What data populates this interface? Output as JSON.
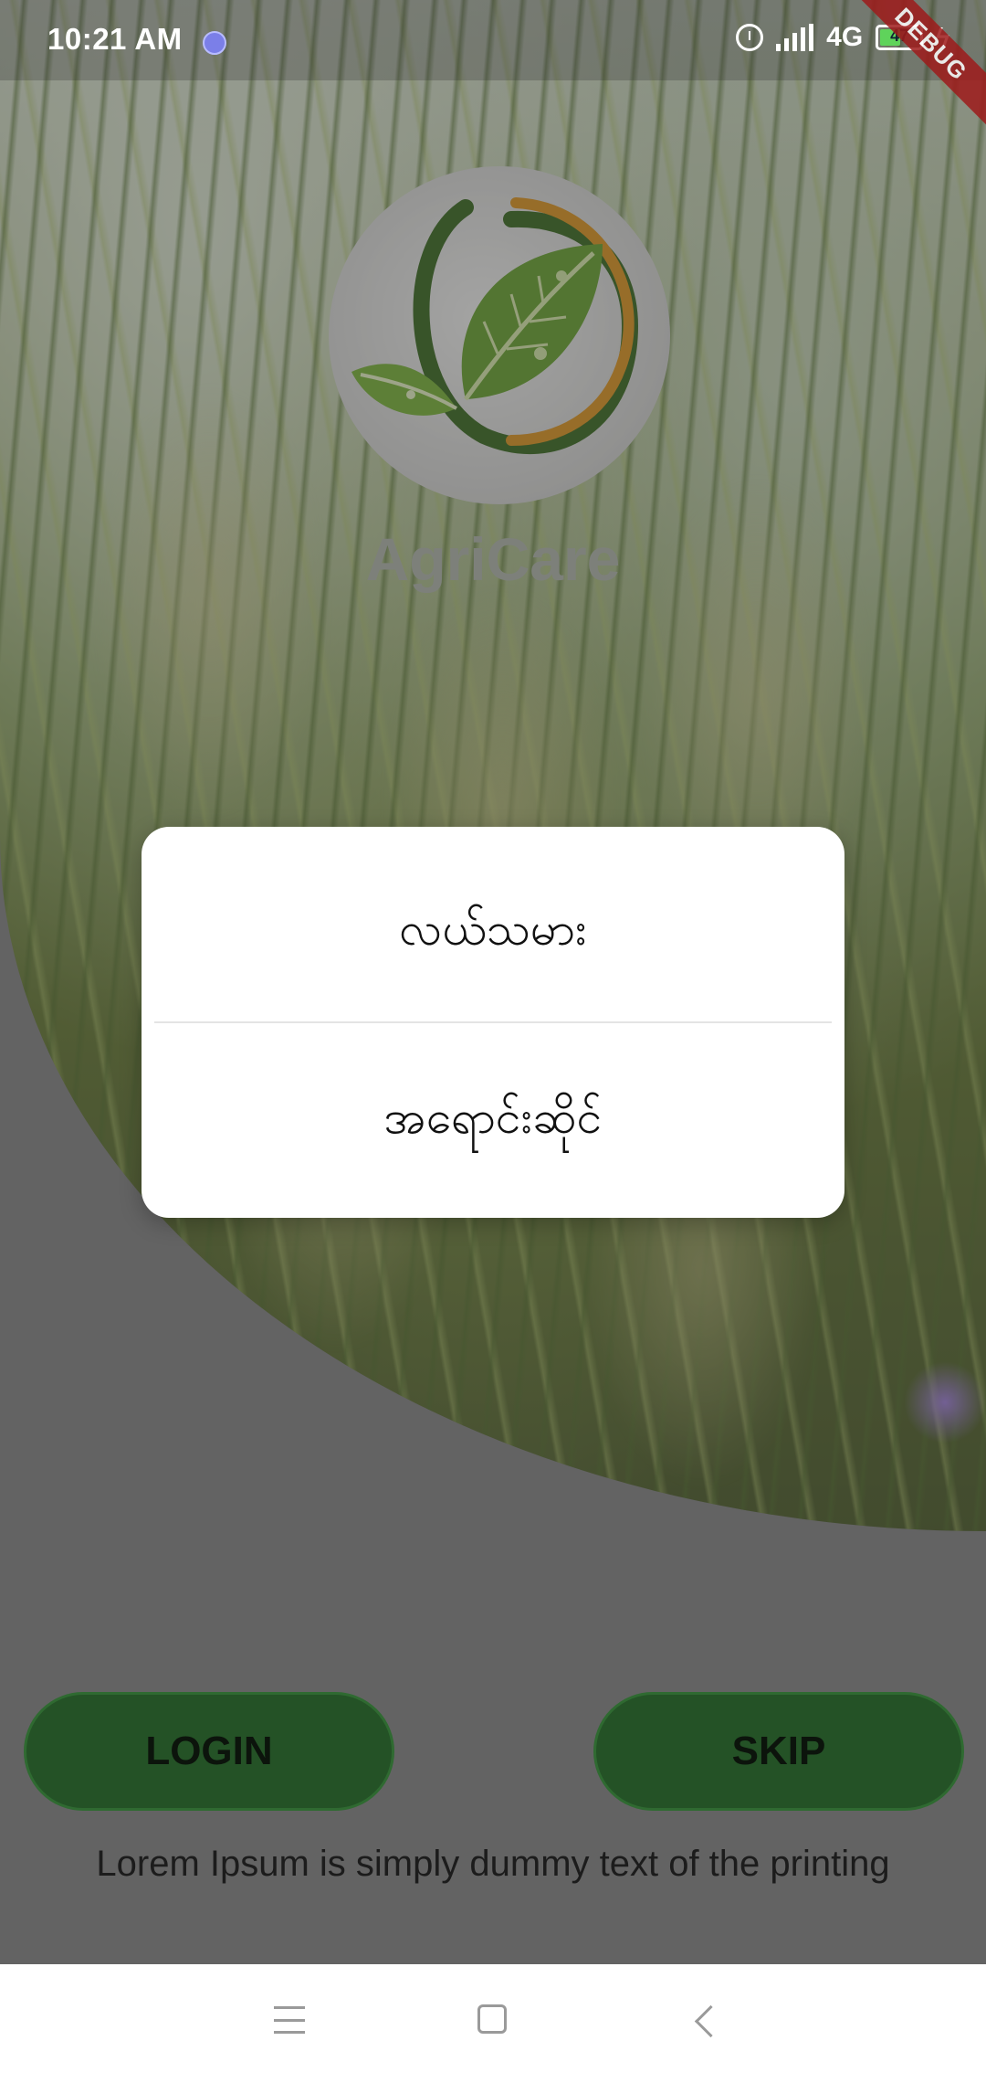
{
  "status_bar": {
    "time": "10:21 AM",
    "network": "4G",
    "battery_percent": "47",
    "icons": [
      "notification-icon",
      "alarm-icon",
      "signal-icon",
      "battery-icon",
      "charging-icon"
    ]
  },
  "debug_banner": "DEBUG",
  "app": {
    "name": "AgriCare",
    "logo_icon": "leaf-logo-icon"
  },
  "dialog": {
    "options": [
      {
        "label": "လယ်သမား"
      },
      {
        "label": "အရောင်းဆိုင်"
      }
    ]
  },
  "buttons": {
    "login": "LOGIN",
    "skip": "SKIP"
  },
  "tagline": "Lorem Ipsum is simply dummy text of the printing",
  "nav_bar": {
    "icons": [
      "menu-icon",
      "home-icon",
      "back-icon"
    ]
  },
  "colors": {
    "button_green": "#245226",
    "dialog_bg": "#ffffff",
    "scrim": "#7a7a7a"
  }
}
